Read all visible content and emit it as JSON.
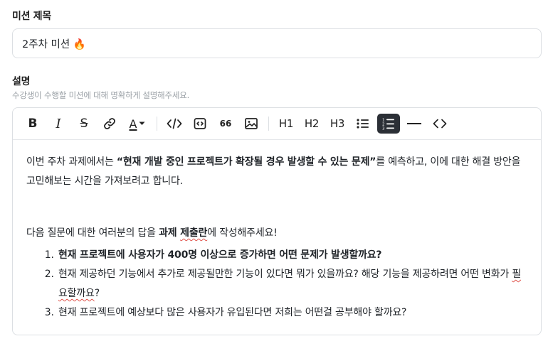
{
  "form": {
    "title_label": "미션 제목",
    "title_value": "2주차 미션 🔥",
    "desc_label": "설명",
    "desc_hint": "수강생이 수행할 미션에 대해 명확하게 설명해주세요."
  },
  "toolbar": {
    "bold": "B",
    "italic": "I",
    "strike": "S",
    "color": "A",
    "quote": "66",
    "h1": "H1",
    "h2": "H2",
    "h3": "H3",
    "icons": [
      "bold-icon",
      "italic-icon",
      "strikethrough-icon",
      "link-icon",
      "text-color-icon",
      "code-icon",
      "code-block-icon",
      "quote-icon",
      "image-icon",
      "bullet-list-icon",
      "ordered-list-icon",
      "horizontal-rule-icon",
      "source-code-icon"
    ],
    "active_color": "#2b2f36"
  },
  "content": {
    "intro_pre": "이번 주차 과제에서는 ",
    "intro_bold": "“현재 개발 중인 프로젝트가 확장될 경우 발생할 수 있는 문제”",
    "intro_post": "를 예측하고, 이에 대한 해결 방안을 고민해보는 시간을 가져보려고 합니다.",
    "answer_pre": "다음 질문에 대한 여러분의 답을 ",
    "answer_bold_a": "과제 ",
    "answer_bold_b": "제출란",
    "answer_post": "에 작성해주세요!",
    "q1": "현재 프로젝트에 사용자가 400명 이상으로 증가하면 어떤 문제가 발생할까요?",
    "q2_a": "현재 제공하던 기능에서 추가로 제공될만한 기능이 있다면 뭐가 있을까요? 해당 기능을 제공하려면 어떤 변화가 ",
    "q2_b": "필요할까요",
    "q2_c": "?",
    "q3": "현재 프로젝트에 예상보다 많은 사용자가 유입된다면 저희는 어떤걸 공부해야 할까요?"
  }
}
